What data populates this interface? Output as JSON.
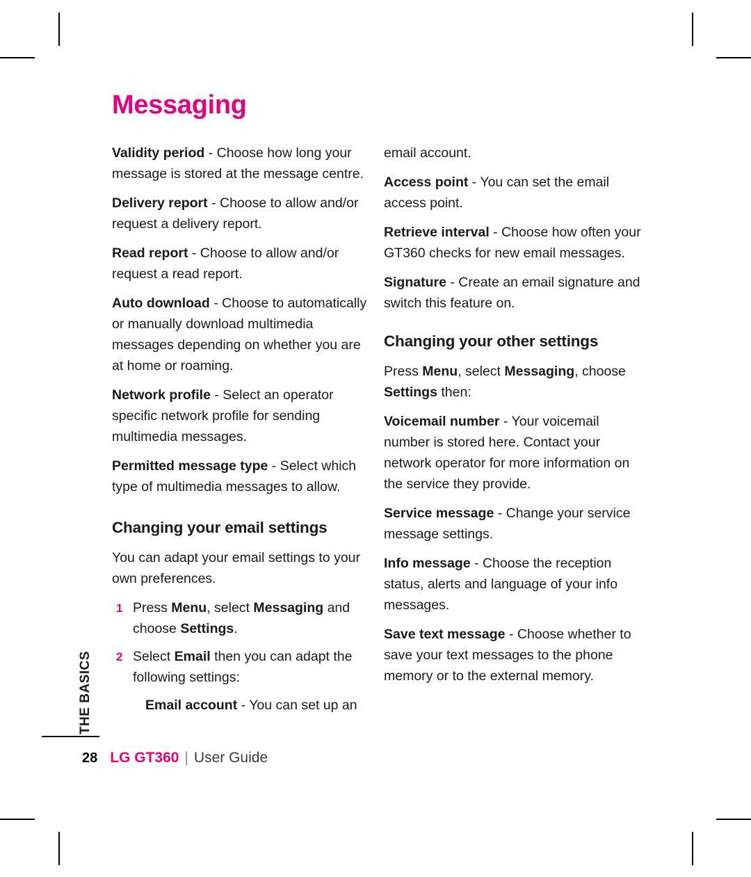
{
  "page": {
    "title": "Messaging",
    "number": "28",
    "footer_brand": "LG GT360",
    "footer_separator": "|",
    "footer_guide": "User Guide",
    "side_tab": "THE BASICS",
    "accent_color": "#e5007d"
  },
  "left_column": {
    "paragraphs": [
      {
        "lead": "Validity period",
        "rest": " - Choose how long your message is stored at the message centre."
      },
      {
        "lead": "Delivery report",
        "rest": " - Choose to allow and/or request a delivery report."
      },
      {
        "lead": "Read report",
        "rest": " - Choose to allow and/or request a read report."
      },
      {
        "lead": "Auto download",
        "rest": " - Choose to automatically or manually download multimedia messages depending on whether you are at home or roaming."
      },
      {
        "lead": "Network profile",
        "rest": " - Select an operator specific network profile for sending multimedia messages."
      },
      {
        "lead": "Permitted message type",
        "rest": " - Select which type of multimedia messages to allow."
      }
    ],
    "heading": "Changing your email settings",
    "intro": "You can adapt your email settings to your own preferences.",
    "steps": [
      {
        "num": "1",
        "pre": "Press ",
        "b1": "Menu",
        "mid": ", select ",
        "b2": "Messaging",
        "post": " and choose ",
        "b3": "Settings",
        "end": "."
      },
      {
        "num": "2",
        "pre": "Select ",
        "b1": "Email",
        "mid": " then you can adapt the following settings:",
        "b2": "",
        "post": "",
        "b3": "",
        "end": ""
      }
    ],
    "substep": {
      "lead": "Email account",
      "rest": " - You can set up an"
    }
  },
  "right_column": {
    "continued": "email account.",
    "paragraphs": [
      {
        "lead": "Access point",
        "rest": " - You can set the email access point."
      },
      {
        "lead": "Retrieve interval",
        "rest": " - Choose how often your GT360 checks for new email messages."
      },
      {
        "lead": "Signature",
        "rest": " - Create an email signature and switch this feature on."
      }
    ],
    "heading": "Changing your other settings",
    "intro": {
      "pre": "Press ",
      "b1": "Menu",
      "mid": ", select ",
      "b2": "Messaging",
      "post": ", choose ",
      "b3": "Settings",
      "end": " then:"
    },
    "paragraphs2": [
      {
        "lead": "Voicemail number",
        "rest": " - Your voicemail number is stored here. Contact your network operator for more information on the service they provide."
      },
      {
        "lead": "Service message",
        "rest": " - Change your service message settings."
      },
      {
        "lead": "Info message",
        "rest": " - Choose the reception status, alerts and language of your info messages."
      },
      {
        "lead": "Save text message",
        "rest": " - Choose whether to save your text messages to the phone memory or to the external memory."
      }
    ]
  }
}
